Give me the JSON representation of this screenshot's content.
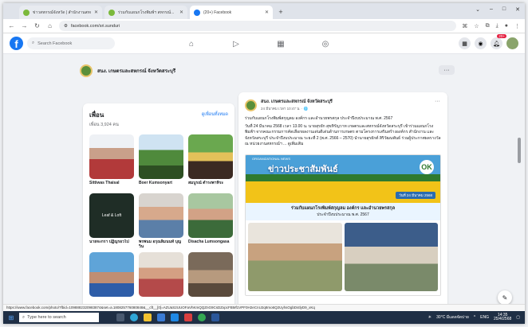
{
  "browser": {
    "tabs": [
      {
        "title": "ข่าวสหกรณ์จังหวัด | สำนักงานสหกรณ์...",
        "favicon": "green"
      },
      {
        "title": "ร่วมกับแผนกโรงพิมพ์ฯ สหกรณ์...",
        "favicon": "green"
      },
      {
        "title": "(20+) Facebook",
        "favicon": "facebook"
      }
    ],
    "new_tab": "+",
    "window_controls": [
      "⌄",
      "–",
      "□",
      "✕"
    ],
    "url": "facebook.com/sri.sunduri",
    "nav": {
      "back": "←",
      "forward": "→",
      "reload": "↻",
      "home": "⌂"
    }
  },
  "facebook": {
    "logo": "f",
    "search_placeholder": "Search Facebook",
    "center_nav_icons": [
      "home-icon",
      "video-icon",
      "marketplace-icon",
      "gaming-icon"
    ],
    "notifications_badge": "20+",
    "page_name": "สนง. เกษตรและสหกรณ์ จังหวัดสระบุรี",
    "more_button": "···"
  },
  "friends": {
    "title": "เพื่อน",
    "count": "เพื่อน 3,924 คน",
    "see_all": "ดูเพื่อนทั้งหมด",
    "items": [
      {
        "name": "Sittiwas Thaisal"
      },
      {
        "name": "Boer Kumsonyart"
      },
      {
        "name": "สมบูรณ์ ดำรงพาหิระ"
      },
      {
        "name": "นายจะกรา ปฏิญรอวไป"
      },
      {
        "name": "พรพนม อรุณลิ่มนนท์ บุญวิน"
      },
      {
        "name": "Disacha Lumsongasa"
      },
      {
        "name": ""
      },
      {
        "name": ""
      },
      {
        "name": ""
      }
    ]
  },
  "post": {
    "author": "สนง. เกษตรและสหกรณ์ จังหวัดสระบุรี",
    "date": "24 มีนาคม เวลา 10:47 น. · 🌐",
    "menu": "···",
    "body_1": "ร่วมกับแผนกโรงพิมพ์สกุญลม องค์กร และอำนวยพรสกุล ประจำปีงบประมาณ พ.ศ. 2567",
    "body_2": "วันที่ 24 มีนาคม 2568 เวลา 13.00 น. นายสุรยัก สุขหิรัญวาท เกษตรและสหกรณ์จังหวัดสระบุรี เข้าร่วมแผนกโรงพิมพ์ฯ จากคณะกรรมการคัดเลือกผลงานเด่นดีเด่นด้านการเกษตร ตามโครงการเสริมสร้างองค์กร สำนักงาน และจังหวัดสระบุรี ประจำปีงบประมาณ ระยะที่ 2 (พ.ศ. 2566 – 2570) นำนายสุรยักต์ สิริวัฒนพันธ์ ร่วมผู้ประกาศผลรางวัล ณ หน่วยงานสหกรณ์ฯ ... ดูเพิ่มเติม",
    "banner": {
      "small_text": "ORGANIZATIONAL NEWS",
      "title": "ข่าวประชาสัมพันธ์",
      "badge": "OK",
      "date": "วันที่ 24 มีนาคม 2568",
      "caption_1": "ร่วมกับแผนกโรงพิมพ์สกุญลม องค์กร และอำนวยพรสกุล",
      "caption_2": "ประจำปีงบประมาณ พ.ศ. 2567"
    }
  },
  "status_url": "https://www.facebook.com/photo/?fbid=1098882320983874&set=a.180825776080848&__cft__[0]=AZUaS2UUOFaVhKmQQZnG9CsDZxpcFBMf1VPF0H2eCnU2q8mo6Q2UyhsOgbDstlyD9_xKq",
  "compose_icon": "✎",
  "taskbar": {
    "search_placeholder": "Type here to search",
    "weather": "30°C มีแดดจัดบ่าย",
    "lang": "ENG",
    "time": "14:35",
    "date": "25/4/2568"
  }
}
